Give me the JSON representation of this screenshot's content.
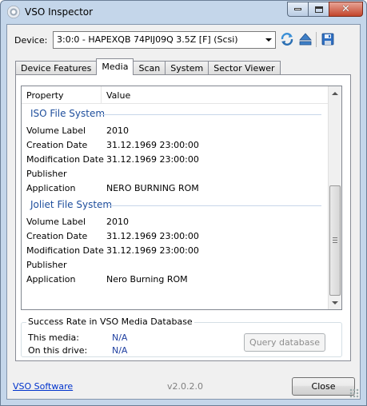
{
  "window": {
    "title": "VSO Inspector"
  },
  "device": {
    "label": "Device:",
    "selected": "3:0:0 - HAPEXQB 74PIJ09Q 3.5Z [F] (Scsi)"
  },
  "tabs": [
    {
      "label": "Device Features",
      "active": false
    },
    {
      "label": "Media",
      "active": true
    },
    {
      "label": "Scan",
      "active": false
    },
    {
      "label": "System",
      "active": false
    },
    {
      "label": "Sector Viewer",
      "active": false
    }
  ],
  "listview": {
    "columns": [
      "Property",
      "Value"
    ],
    "groups": [
      {
        "title": "ISO File System",
        "rows": [
          {
            "property": "Volume Label",
            "value": "2010"
          },
          {
            "property": "Creation Date",
            "value": "31.12.1969 23:00:00"
          },
          {
            "property": "Modification Date",
            "value": "31.12.1969 23:00:00"
          },
          {
            "property": "Publisher",
            "value": ""
          },
          {
            "property": "Application",
            "value": "NERO BURNING ROM"
          }
        ]
      },
      {
        "title": "Joliet File System",
        "rows": [
          {
            "property": "Volume Label",
            "value": "2010"
          },
          {
            "property": "Creation Date",
            "value": "31.12.1969 23:00:00"
          },
          {
            "property": "Modification Date",
            "value": "31.12.1969 23:00:00"
          },
          {
            "property": "Publisher",
            "value": ""
          },
          {
            "property": "Application",
            "value": "Nero Burning ROM"
          }
        ]
      }
    ]
  },
  "success_rate": {
    "title": "Success Rate in VSO Media Database",
    "this_media_label": "This media:",
    "this_media_value": "N/A",
    "this_drive_label": "On this drive:",
    "this_drive_value": "N/A",
    "query_button": "Query database"
  },
  "footer": {
    "link": "VSO Software",
    "version": "v2.0.2.0",
    "close_button": "Close"
  },
  "icons": {
    "refresh": "refresh-icon",
    "eject": "eject-icon",
    "save": "save-icon"
  },
  "colors": {
    "group_header": "#1e4e9c",
    "status_value": "#1f3fa0",
    "link": "#0033cc",
    "close_button_accent": "#c3452b"
  }
}
